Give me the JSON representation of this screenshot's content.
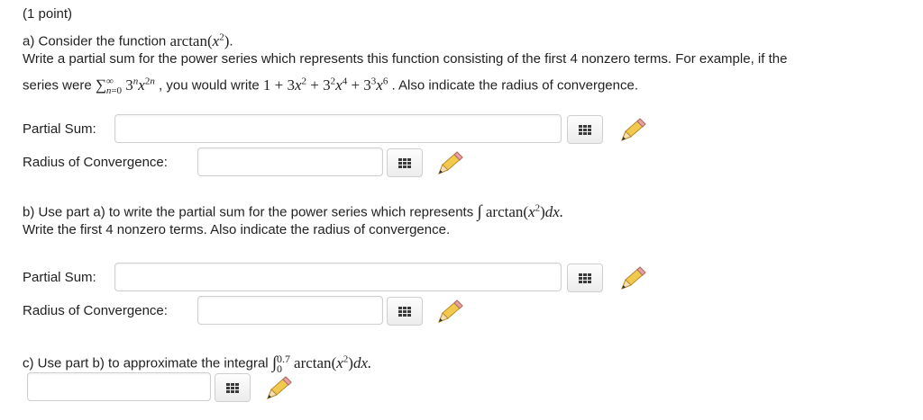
{
  "header": {
    "points": "(1 point)"
  },
  "part_a": {
    "intro_prefix": "a) Consider the function ",
    "function": "arctan",
    "intro_suffix": ".",
    "line2": "Write a partial sum for the power series which represents this function consisting of the first 4 nonzero terms. For example, if the",
    "series_were": "series were ",
    "you_would_write": " , you would write ",
    "also": " . Also indicate the radius of convergence.",
    "partial_sum_label": "Partial Sum:",
    "radius_label": "Radius of Convergence:",
    "partial_sum_value": "",
    "radius_value": ""
  },
  "part_b": {
    "line1": "b) Use part a) to write the partial sum for the power series which represents",
    "integral_text": "arctan",
    "dx": "dx.",
    "line2": "Write the first 4 nonzero terms. Also indicate the radius of convergence.",
    "partial_sum_label": "Partial Sum:",
    "radius_label": "Radius of Convergence:",
    "partial_sum_value": "",
    "radius_value": ""
  },
  "part_c": {
    "line1": "c) Use part b) to approximate the integral",
    "upper_limit": "0.7",
    "lower_limit": "0",
    "integral_text": "arctan",
    "dx": "dx.",
    "answer_value": ""
  },
  "icons": {
    "matrix": "matrix-grid-icon",
    "pencil": "pencil-icon"
  }
}
